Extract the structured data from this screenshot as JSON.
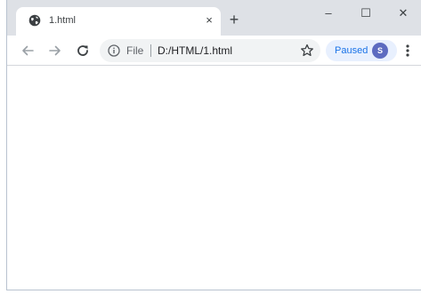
{
  "tab": {
    "title": "1.html",
    "close_glyph": "×",
    "favicon_icon": "globe-icon"
  },
  "new_tab_glyph": "+",
  "window_controls": {
    "minimize": "–",
    "maximize": "☐",
    "close": "✕"
  },
  "toolbar": {
    "back_icon": "arrow-left-icon",
    "forward_icon": "arrow-right-icon",
    "reload_icon": "reload-icon",
    "omnibox": {
      "info_icon": "info-icon",
      "scheme_label": "File",
      "url": "D:/HTML/1.html",
      "star_icon": "star-icon"
    },
    "profile": {
      "label": "Paused",
      "avatar_letter": "S"
    },
    "menu_icon": "kebab-menu-icon"
  },
  "colors": {
    "titlebar": "#dee1e6",
    "omnibox": "#f1f3f4",
    "profile_chip": "#e8f0fe",
    "profile_text": "#1a73e8",
    "avatar": "#5c6bc0"
  }
}
